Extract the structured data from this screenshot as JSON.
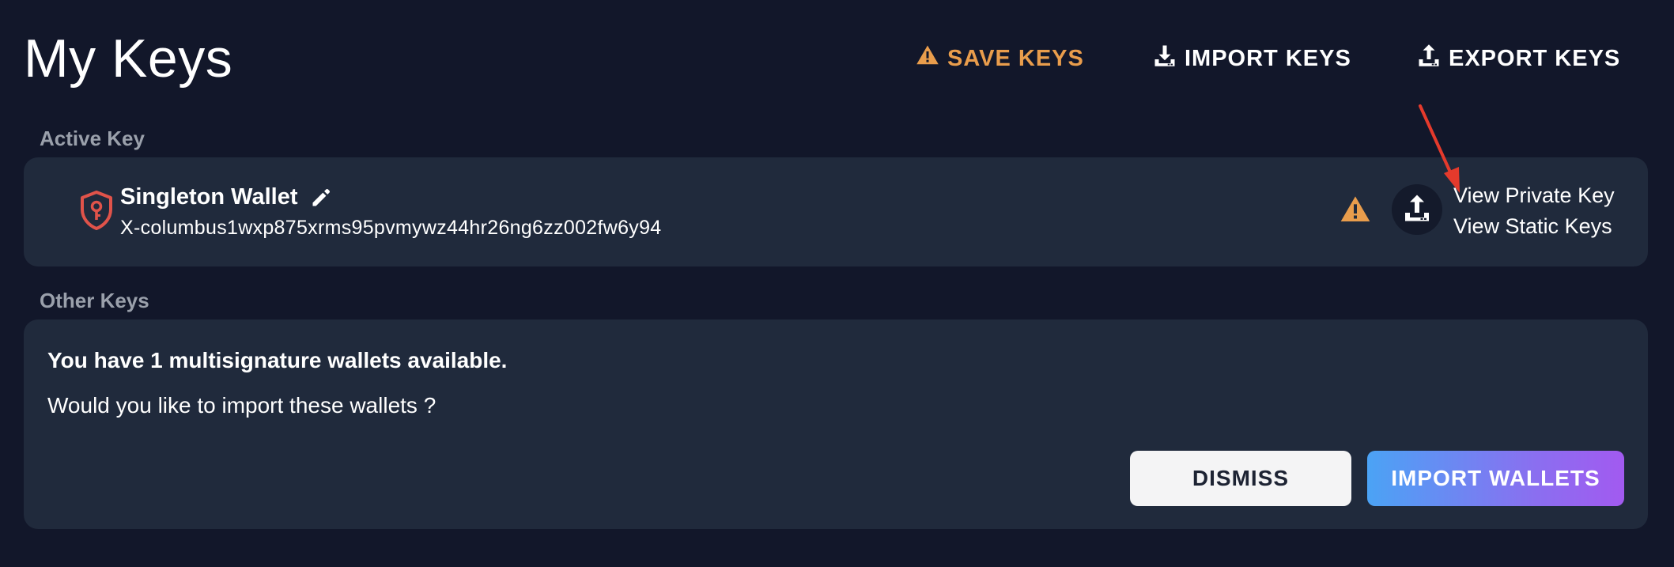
{
  "header": {
    "title": "My Keys",
    "save_keys": "SAVE KEYS",
    "import_keys": "IMPORT KEYS",
    "export_keys": "EXPORT KEYS"
  },
  "active_key": {
    "section_label": "Active Key",
    "wallet_name": "Singleton Wallet",
    "address": "X-columbus1wxp875xrms95pvmywz44hr26ng6zz002fw6y94",
    "view_private_key": "View Private Key",
    "view_static_keys": "View Static Keys"
  },
  "other_keys": {
    "section_label": "Other Keys",
    "message_title": "You have 1 multisignature wallets available.",
    "message_question": "Would you like to import these wallets ?",
    "dismiss_label": "DISMISS",
    "import_wallets_label": "IMPORT WALLETS"
  },
  "colors": {
    "background": "#12172a",
    "card": "#202a3c",
    "warning": "#e99d4c",
    "shield": "#e0534a",
    "annotation": "#e53a2c"
  },
  "icons": [
    "warning-icon",
    "download-icon",
    "upload-icon",
    "shield-key-icon",
    "pencil-icon"
  ]
}
